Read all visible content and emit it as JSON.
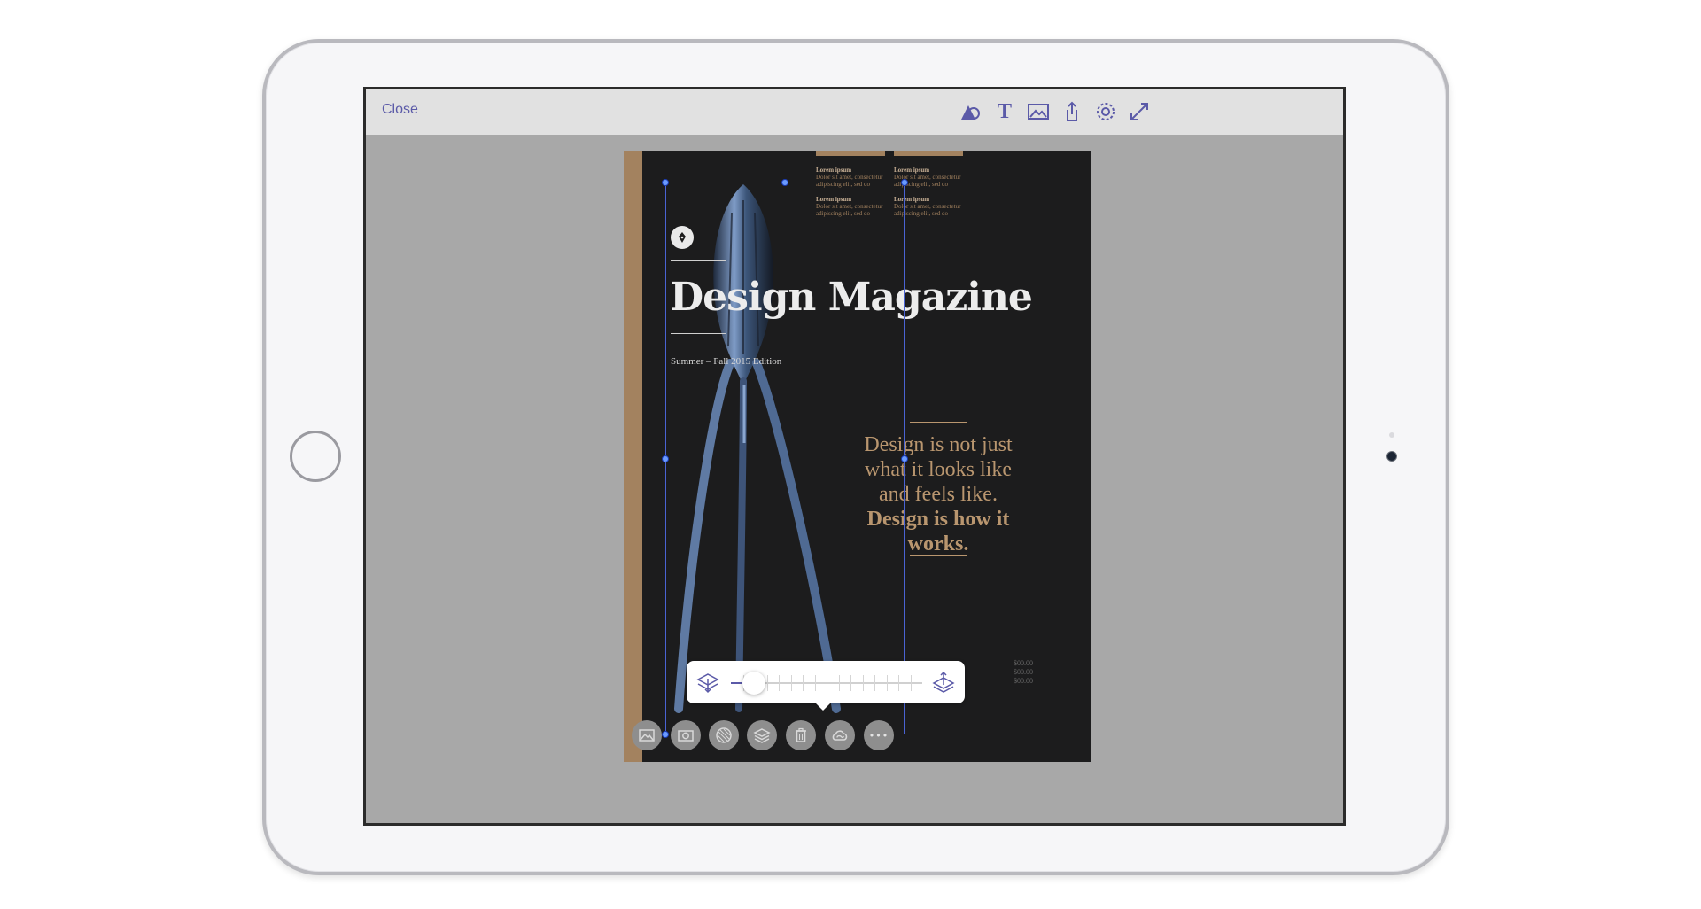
{
  "topbar": {
    "close_label": "Close",
    "tools": [
      {
        "icon": "shape-icon"
      },
      {
        "icon": "text-icon",
        "glyph": "T"
      },
      {
        "icon": "image-icon"
      },
      {
        "icon": "share-icon"
      },
      {
        "icon": "gear-icon"
      },
      {
        "icon": "expand-icon"
      }
    ]
  },
  "magazine": {
    "columns": [
      {
        "heading": "Lorem ipsum",
        "body": "Dolor sit amet, consectetur adipiscing elit, sed do"
      },
      {
        "heading": "Lorem ipsum",
        "body": "Dolor sit amet, consectetur adipiscing elit, sed do"
      },
      {
        "heading": "Lorem ipsum",
        "body": "Dolor sit amet, consectetur adipiscing elit, sed do"
      },
      {
        "heading": "Lorem ipsum",
        "body": "Dolor sit amet, consectetur adipiscing elit, sed do"
      }
    ],
    "title": "Design Magazine",
    "edition": "Summer – Fall 2015 Edition",
    "quote_regular": "Design is not just what it looks like and feels like.",
    "quote_bold": "Design is how it works.",
    "prices": [
      "$00.00",
      "$00.00",
      "$00.00"
    ]
  },
  "slider": {
    "value_fraction": 0.12,
    "tick_count": 15
  },
  "bottom_tools": [
    {
      "icon": "image-icon"
    },
    {
      "icon": "camera-icon"
    },
    {
      "icon": "transparency-icon"
    },
    {
      "icon": "layers-icon"
    },
    {
      "icon": "trash-icon"
    },
    {
      "icon": "creative-cloud-icon"
    },
    {
      "icon": "more-icon",
      "glyph": "•••"
    }
  ],
  "colors": {
    "accent": "#5b5aa8",
    "magazine_bg": "#1c1c1d",
    "gold": "#a3825f",
    "selection": "#4a63d3"
  }
}
